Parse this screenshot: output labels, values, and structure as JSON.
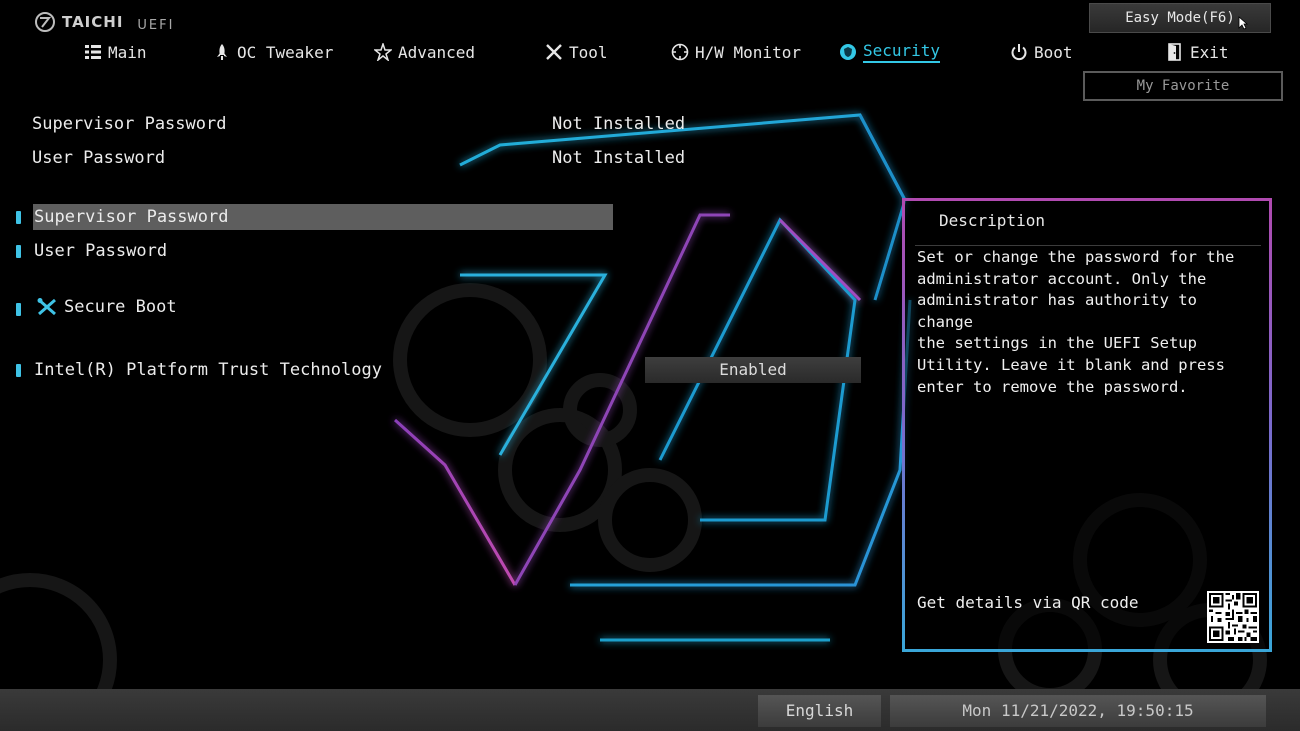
{
  "header": {
    "brand": "TAICHI",
    "brand_suffix": "UEFI",
    "easy_mode_label": "Easy Mode(F6)",
    "my_favorite_label": "My Favorite"
  },
  "tabs": [
    {
      "label": "Main",
      "icon": "list-icon"
    },
    {
      "label": "OC Tweaker",
      "icon": "rocket-icon"
    },
    {
      "label": "Advanced",
      "icon": "star-icon"
    },
    {
      "label": "Tool",
      "icon": "tools-icon"
    },
    {
      "label": "H/W Monitor",
      "icon": "crosshair-icon"
    },
    {
      "label": "Security",
      "icon": "shield-icon",
      "active": true
    },
    {
      "label": "Boot",
      "icon": "power-icon"
    },
    {
      "label": "Exit",
      "icon": "door-icon"
    }
  ],
  "status": [
    {
      "label": "Supervisor Password",
      "value": "Not Installed"
    },
    {
      "label": "User Password",
      "value": "Not Installed"
    }
  ],
  "menu": {
    "supervisor_password": "Supervisor Password",
    "user_password": "User Password",
    "secure_boot": "Secure Boot",
    "ptt_label": "Intel(R) Platform Trust Technology",
    "ptt_value": "Enabled"
  },
  "description": {
    "title": "Description",
    "body": "Set or change the password for the\nadministrator account. Only the\nadministrator has authority to change\nthe settings in the UEFI Setup\nUtility. Leave it blank and press\nenter to remove the password.",
    "qr_label": "Get details via QR code"
  },
  "footer": {
    "language": "English",
    "datetime": "Mon 11/21/2022, 19:50:15"
  },
  "colors": {
    "accent": "#33c8e6",
    "selected_row": "#5e5e5e",
    "panel_border_top": "#b04ab0",
    "panel_border_bottom": "#3aa6d8"
  }
}
